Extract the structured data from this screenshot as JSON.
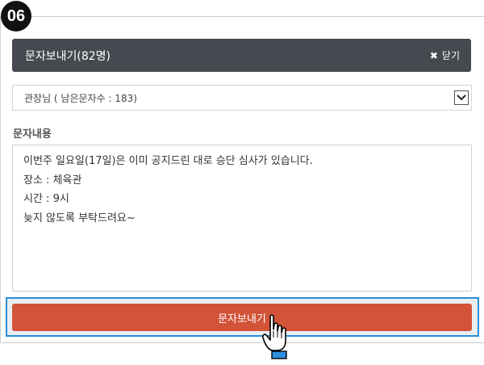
{
  "step": {
    "number": "06"
  },
  "header": {
    "title": "문자보내기(82명)",
    "close_label": "닫기",
    "close_icon": "close-icon"
  },
  "sender_select": {
    "selected": "관장님 ( 남은문자수 : 183)"
  },
  "message": {
    "label": "문자내용",
    "lines": [
      "이번주 일요일(17일)은 이미 공지드린 대로 승단 심사가 있습니다.",
      "장소 : 체육관",
      "시간 : 9시",
      "늦지 않도록 부탁드려요~"
    ]
  },
  "send_button": {
    "label": "문자보내기"
  },
  "colors": {
    "header_bg": "#464a50",
    "send_bg": "#d35339",
    "focus_border": "#2c8ed6"
  }
}
